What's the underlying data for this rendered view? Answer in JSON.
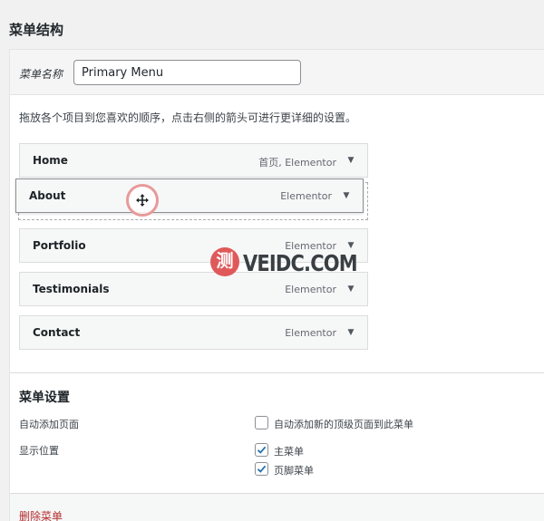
{
  "page": {
    "title": "菜单结构"
  },
  "menu_name": {
    "label": "菜单名称",
    "value": "Primary Menu"
  },
  "instructions": "拖放各个项目到您喜欢的顺序，点击右侧的箭头可进行更详细的设置。",
  "menu_items": [
    {
      "title": "Home",
      "type": "首页, Elementor"
    },
    {
      "title": "About",
      "type": "Elementor"
    },
    {
      "title": "Portfolio",
      "type": "Elementor"
    },
    {
      "title": "Testimonials",
      "type": "Elementor"
    },
    {
      "title": "Contact",
      "type": "Elementor"
    }
  ],
  "settings": {
    "title": "菜单设置",
    "auto_add": {
      "label": "自动添加页面",
      "option": "自动添加新的顶级页面到此菜单",
      "checked": false
    },
    "display_location": {
      "label": "显示位置",
      "options": [
        {
          "label": "主菜单",
          "checked": true
        },
        {
          "label": "页脚菜单",
          "checked": true
        }
      ]
    }
  },
  "delete_label": "删除菜单",
  "watermark": {
    "seal": "测",
    "text": "VEIDC.COM"
  },
  "colors": {
    "accent": "#2271b1",
    "danger": "#b32d2e",
    "cursor_ring": "#e79a9a",
    "seal": "#e0595a"
  }
}
